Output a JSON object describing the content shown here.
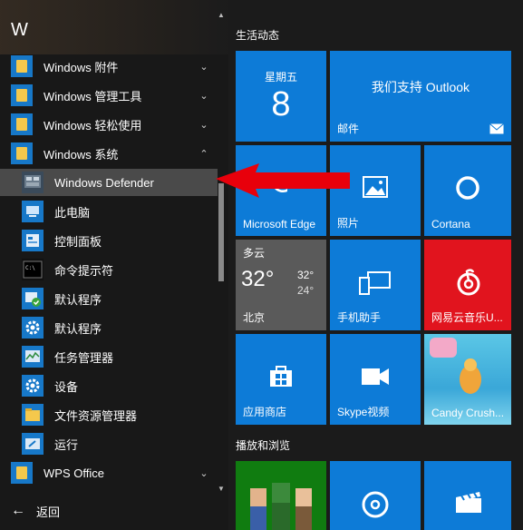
{
  "left_panel": {
    "section_letter": "W",
    "items": [
      {
        "label": "Windows 附件",
        "chev": "⌄"
      },
      {
        "label": "Windows 管理工具",
        "chev": "⌄"
      },
      {
        "label": "Windows 轻松使用",
        "chev": "⌄"
      },
      {
        "label": "Windows 系统",
        "chev": "⌃"
      },
      {
        "label": "Windows Defender"
      },
      {
        "label": "此电脑"
      },
      {
        "label": "控制面板"
      },
      {
        "label": "命令提示符"
      },
      {
        "label": "默认程序"
      },
      {
        "label": "默认程序"
      },
      {
        "label": "任务管理器"
      },
      {
        "label": "设备"
      },
      {
        "label": "文件资源管理器"
      },
      {
        "label": "运行"
      },
      {
        "label": "WPS Office",
        "chev": "⌄"
      }
    ],
    "back_label": "返回"
  },
  "right_panel": {
    "group1_title": "生活动态",
    "group2_title": "播放和浏览",
    "calendar": {
      "weekday": "星期五",
      "day": "8"
    },
    "mail": {
      "title": "我们支持 Outlook",
      "label": "邮件"
    },
    "edge": {
      "label": "Microsoft Edge"
    },
    "photos": {
      "label": "照片"
    },
    "cortana": {
      "label": "Cortana"
    },
    "weather": {
      "condition": "多云",
      "temp": "32°",
      "high": "32°",
      "low": "24°",
      "city": "北京"
    },
    "phone": {
      "label": "手机助手"
    },
    "netease": {
      "label": "网易云音乐U..."
    },
    "store": {
      "label": "应用商店"
    },
    "skype": {
      "label": "Skype视频"
    },
    "candy": {
      "label": "Candy Crush..."
    }
  },
  "colors": {
    "tile_blue": "#0d7bd7",
    "netease_red": "#e1141e",
    "weather_gray": "#5a5a5a",
    "arrow_red": "#e8000b"
  }
}
